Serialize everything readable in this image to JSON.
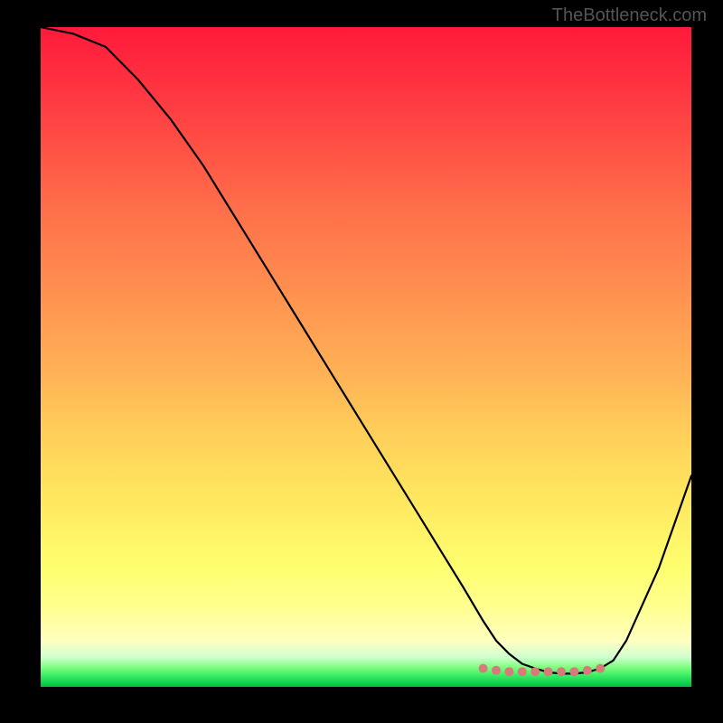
{
  "watermark": "TheBottleneck.com",
  "chart_data": {
    "type": "line",
    "title": "",
    "xlabel": "",
    "ylabel": "",
    "xlim": [
      0,
      100
    ],
    "ylim": [
      0,
      100
    ],
    "x": [
      0,
      5,
      10,
      15,
      20,
      25,
      30,
      35,
      40,
      45,
      50,
      55,
      60,
      65,
      68,
      70,
      72,
      74,
      76,
      78,
      80,
      82,
      84,
      86,
      88,
      90,
      95,
      100
    ],
    "values": [
      100,
      99,
      97,
      92,
      86,
      79,
      71,
      63,
      55,
      47,
      39,
      31,
      23,
      15,
      10,
      7,
      5,
      3.5,
      2.8,
      2.2,
      2,
      2,
      2.2,
      2.8,
      4,
      7,
      18,
      32
    ],
    "markers": {
      "x": [
        68,
        70,
        72,
        74,
        76,
        78,
        80,
        82,
        84,
        86
      ],
      "y": [
        2.8,
        2.5,
        2.3,
        2.3,
        2.3,
        2.3,
        2.3,
        2.3,
        2.5,
        2.8
      ],
      "color": "#d97a7a"
    },
    "gradient_scale": {
      "top_color": "#ff1a3a",
      "mid_color": "#ffe860",
      "bottom_color": "#00c040"
    }
  }
}
